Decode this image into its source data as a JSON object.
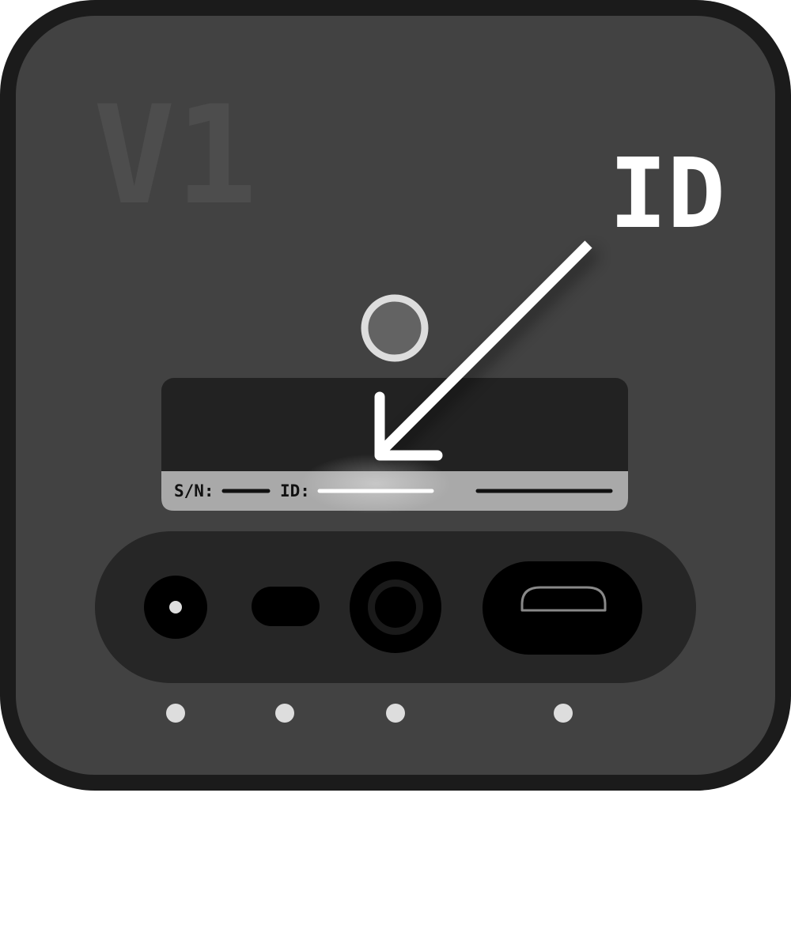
{
  "device": {
    "version_label": "V1",
    "id_callout_label": "ID",
    "sticker": {
      "serial_label": "S/N:",
      "id_label": "ID:"
    },
    "ports": [
      {
        "name": "dc-power-jack"
      },
      {
        "name": "switch-slot"
      },
      {
        "name": "audio-jack"
      },
      {
        "name": "micro-usb-port"
      }
    ]
  },
  "colors": {
    "body_outline": "#1b1b1b",
    "body_fill": "#424242",
    "version_text": "#4d4d4d",
    "callout": "#ffffff",
    "led_ring": "#dddddd",
    "led_fill": "#636363",
    "sticker_dark": "#222222",
    "sticker_light": "#a9a9a9",
    "port_panel": "#262626",
    "port_fill": "#000000",
    "indicator_dot": "#dddddd"
  }
}
